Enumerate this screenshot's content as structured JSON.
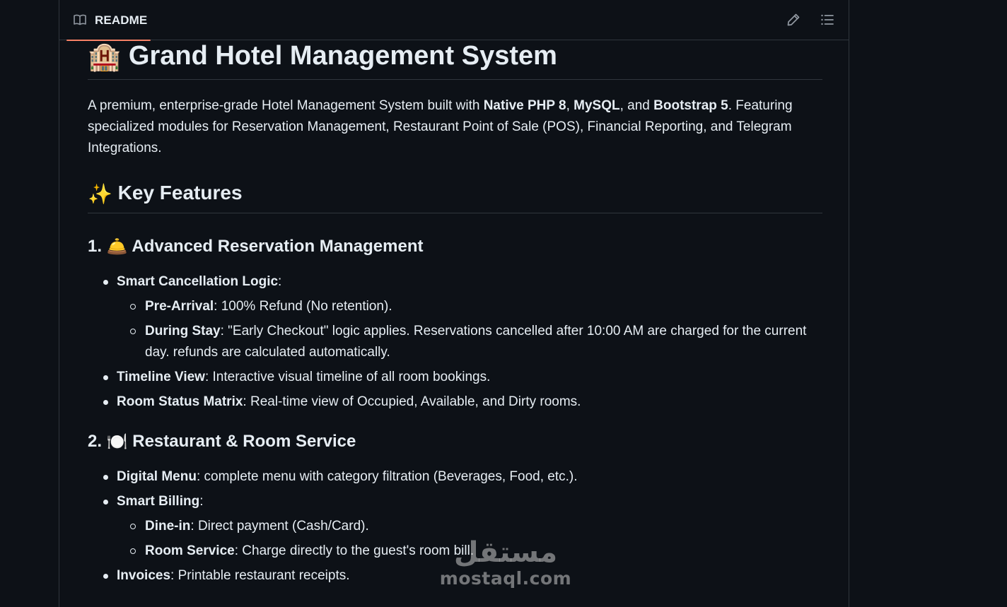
{
  "readme": {
    "tab_label": "README",
    "icons": {
      "tab": "book-icon",
      "edit": "pencil-icon",
      "toc": "list-icon"
    },
    "accent_color": "#f78166",
    "title_emoji": "🏨",
    "title": "Grand Hotel Management System",
    "intro": {
      "t1": "A premium, enterprise-grade Hotel Management System built with ",
      "b1": "Native PHP 8",
      "t2": ", ",
      "b2": "MySQL",
      "t3": ", and ",
      "b3": "Bootstrap 5",
      "t4": ". Featuring specialized modules for Reservation Management, Restaurant Point of Sale (POS), Financial Reporting, and Telegram Integrations."
    },
    "features_emoji": "✨",
    "features_heading": "Key Features",
    "section1": {
      "number": "1.",
      "emoji": "🛎️",
      "title": "Advanced Reservation Management",
      "items": [
        {
          "key": "Smart Cancellation Logic",
          "text": ":",
          "sub": [
            {
              "key": "Pre-Arrival",
              "text": ": 100% Refund (No retention)."
            },
            {
              "key": "During Stay",
              "text": ": \"Early Checkout\" logic applies. Reservations cancelled after 10:00 AM are charged for the current day. refunds are calculated automatically."
            }
          ]
        },
        {
          "key": "Timeline View",
          "text": ": Interactive visual timeline of all room bookings."
        },
        {
          "key": "Room Status Matrix",
          "text": ": Real-time view of Occupied, Available, and Dirty rooms."
        }
      ]
    },
    "section2": {
      "number": "2.",
      "emoji": "🍽️",
      "title": "Restaurant & Room Service",
      "items": [
        {
          "key": "Digital Menu",
          "text": ": complete menu with category filtration (Beverages, Food, etc.)."
        },
        {
          "key": "Smart Billing",
          "text": ":",
          "sub": [
            {
              "key": "Dine-in",
              "text": ": Direct payment (Cash/Card)."
            },
            {
              "key": "Room Service",
              "text": ": Charge directly to the guest's room bill."
            }
          ]
        },
        {
          "key": "Invoices",
          "text": ": Printable restaurant receipts."
        }
      ]
    }
  },
  "watermark": {
    "arabic": "مستقل",
    "latin": "mostaql.com"
  }
}
